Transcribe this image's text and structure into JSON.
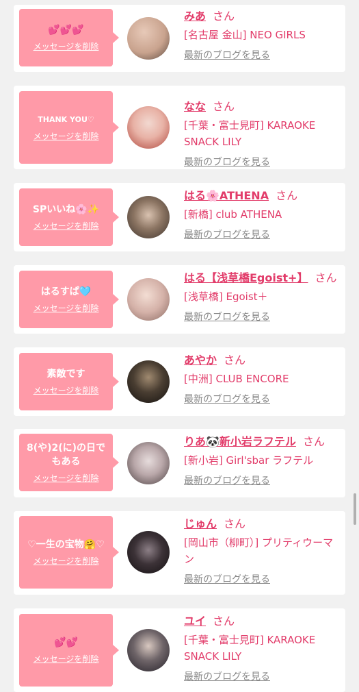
{
  "entries": [
    {
      "message": "💕💕💕",
      "delete_label": "メッセージを削除",
      "name": "みあ",
      "honorific": "さん",
      "shop": "[名古屋 金山] NEO GIRLS",
      "blog_label": "最新のブログを見る",
      "avatar_color": "#c9a38e"
    },
    {
      "message": "THANK YOU♡",
      "delete_label": "メッセージを削除",
      "name": "なな",
      "honorific": "さん",
      "shop": "[千葉・富士見町] KARAOKE SNACK LILY",
      "blog_label": "最新のブログを見る",
      "avatar_color": "#e8b2a6"
    },
    {
      "message": "SPいいね🌸✨",
      "delete_label": "メッセージを削除",
      "name": "はる🌸ATHENA",
      "honorific": "さん",
      "shop": "[新橋] club ATHENA",
      "blog_label": "最新のブログを見る",
      "avatar_color": "#6b5a4e"
    },
    {
      "message": "はるすぱ🩵",
      "delete_label": "メッセージを削除",
      "name": "はる【浅草橋Egoist+】",
      "honorific": "さん",
      "shop": "[浅草橋] Egoist＋",
      "blog_label": "最新のブログを見る",
      "avatar_color": "#d4b1a8"
    },
    {
      "message": "素敵です",
      "delete_label": "メッセージを削除",
      "name": "あやか",
      "honorific": "さん",
      "shop": "[中洲] CLUB ENCORE",
      "blog_label": "最新のブログを見る",
      "avatar_color": "#2b2620"
    },
    {
      "message": "8(や)2(に)の日でもある",
      "delete_label": "メッセージを削除",
      "name": "りあ🐼新小岩ラフテル",
      "honorific": "さん",
      "shop": "[新小岩] Girl'sbar ラフテル",
      "blog_label": "最新のブログを見る",
      "avatar_color": "#b9a7a9"
    },
    {
      "message": "♡一生の宝物🤗♡",
      "delete_label": "メッセージを削除",
      "name": "じゅん",
      "honorific": "さん",
      "shop": "[岡山市（柳町）] プリティウーマン",
      "blog_label": "最新のブログを見る",
      "avatar_color": "#2a2225"
    },
    {
      "message": "💕💕",
      "delete_label": "メッセージを削除",
      "name": "ユイ",
      "honorific": "さん",
      "shop": "[千葉・富士見町] KARAOKE SNACK LILY",
      "blog_label": "最新のブログを見る",
      "avatar_color": "#4a4a4e"
    }
  ]
}
